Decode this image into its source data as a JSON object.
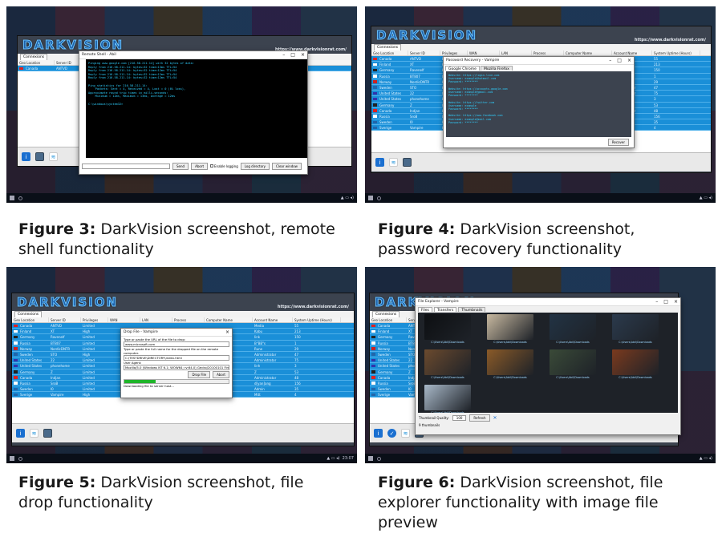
{
  "captions": [
    {
      "label": "Figure 3:",
      "text": "DarkVision screenshot, remote shell functionality"
    },
    {
      "label": "Figure 4:",
      "text": "DarkVision screenshot, password recovery functionality"
    },
    {
      "label": "Figure 5:",
      "text": "DarkVision screenshot, file drop functionality"
    },
    {
      "label": "Figure 6:",
      "text": "DarkVision screenshot, file explorer functionality with image file preview"
    }
  ],
  "app": {
    "logo": "DARKVISION",
    "url": "https://www.darkvisionrat.com/",
    "tab": "Connexions"
  },
  "columns": [
    "Geo Location",
    "Server ID",
    "Privileges",
    "WAN",
    "LAN",
    "Process",
    "Computer Name",
    "Account Name",
    "System Uptime (Hours)"
  ],
  "rows": [
    {
      "country": "Canada",
      "id": "ANTVD",
      "priv": "Limited",
      "acct": "Media",
      "up": "55"
    },
    {
      "country": "Finland",
      "id": "XT",
      "priv": "High",
      "acct": "Kabu",
      "up": "213"
    },
    {
      "country": "Germany",
      "id": "Ravenelf",
      "priv": "Limited",
      "acct": "link",
      "up": "150"
    },
    {
      "country": "Russia",
      "id": "BT807",
      "priv": "Limited",
      "acct": "B\"BB\"s",
      "up": "1"
    },
    {
      "country": "Norway",
      "id": "NordicDNTR",
      "priv": "Limited",
      "acct": "Rune",
      "up": "29"
    },
    {
      "country": "Sweden",
      "id": "STO",
      "priv": "High",
      "acct": "Administrator",
      "up": "47"
    },
    {
      "country": "United States",
      "id": "22",
      "priv": "Limited",
      "acct": "Administrator",
      "up": "75"
    },
    {
      "country": "United States",
      "id": "phonehome",
      "priv": "Limited",
      "acct": "linh",
      "up": "3"
    },
    {
      "country": "Germany",
      "id": "Z",
      "priv": "Limited",
      "acct": "Z",
      "up": "53"
    },
    {
      "country": "Canada",
      "id": "Indjan",
      "priv": "Limited",
      "acct": "Administrator",
      "up": "48"
    },
    {
      "country": "Russia",
      "id": "SroB",
      "priv": "Limited",
      "acct": "d[yan]ang",
      "up": "156"
    },
    {
      "country": "Sweden",
      "id": "I0",
      "priv": "Limited",
      "acct": "Admin",
      "up": "35"
    },
    {
      "country": "Sverige",
      "id": "Vampire",
      "priv": "High",
      "acct": "Mitt",
      "up": "4"
    }
  ],
  "shell": {
    "title": "Remote Shell - Abil",
    "lines": [
      "Pinging www.google.com [216.58.211.14] with 32 bytes of data:",
      "Reply from 216.58.211.14: bytes=32 time=13ms TTL=54",
      "Reply from 216.58.211.14: bytes=32 time=12ms TTL=54",
      "Reply from 216.58.211.14: bytes=32 time=12ms TTL=54",
      "Reply from 216.58.211.14: bytes=32 time=12ms TTL=54",
      "",
      "Ping statistics for 216.58.211.14:",
      "    Packets: Sent = 4, Received = 4, Lost = 0 (0% loss),",
      "Approximate round trip times in milli-seconds:",
      "    Minimum = 12ms, Maximum = 13ms, Average = 12ms",
      "",
      "C:\\windows\\system32>"
    ],
    "send": "Send",
    "abort": "Abort",
    "logging": "Enable logging",
    "logdir": "Log directory",
    "clear": "Clear window"
  },
  "pw": {
    "title": "Password Recovery - Vampire",
    "tabs": [
      "Google Chrome",
      "Mozilla Firefox"
    ],
    "entries": [
      "Website: https://login.live.com",
      "Username: example@hotmail.com",
      "Password: ********",
      "",
      "Website: https://accounts.google.com",
      "Username: example@gmail.com",
      "Password: ********",
      "",
      "Website: https://twitter.com",
      "Username: example",
      "Password: ********",
      "",
      "Website: https://www.facebook.com",
      "Username: example@mail.com",
      "Password: ********"
    ],
    "recover": "Recover"
  },
  "drop": {
    "title": "Drop File - Vampire",
    "l1": "Type or paste the URL of the file to drop:",
    "v1": "www.microsoft.com",
    "l2": "Type or paste the full name for the dropped file on the remote computer.",
    "v2": "C:\\TESTDRIVE\\DIRECTORY\\index.html",
    "l3": "User Agent:",
    "v3": "Mozilla/5.0 (Windows NT 6.1; WOW64; rv:64.0) Gecko/20100101 Firefox/64.0",
    "btn": "Drop File",
    "abort": "Abort",
    "status": "Downloading file to server host...",
    "progress": 0.3
  },
  "fe": {
    "title": "File Explorer - Vampire",
    "tabs": [
      "Files",
      "Transfers",
      "Thumbnails"
    ],
    "caption_line": "C:\\Users\\Abil\\Downloads",
    "quality_label": "Thumbnail Quality:",
    "quality": "100",
    "refresh": "Refresh",
    "status": "9 thumbnails"
  },
  "taskbar": {
    "time": "23:07"
  },
  "colors": {
    "accent": "#1a8fd8",
    "bg": "#3c434f",
    "logo": "#1c5fa8"
  }
}
